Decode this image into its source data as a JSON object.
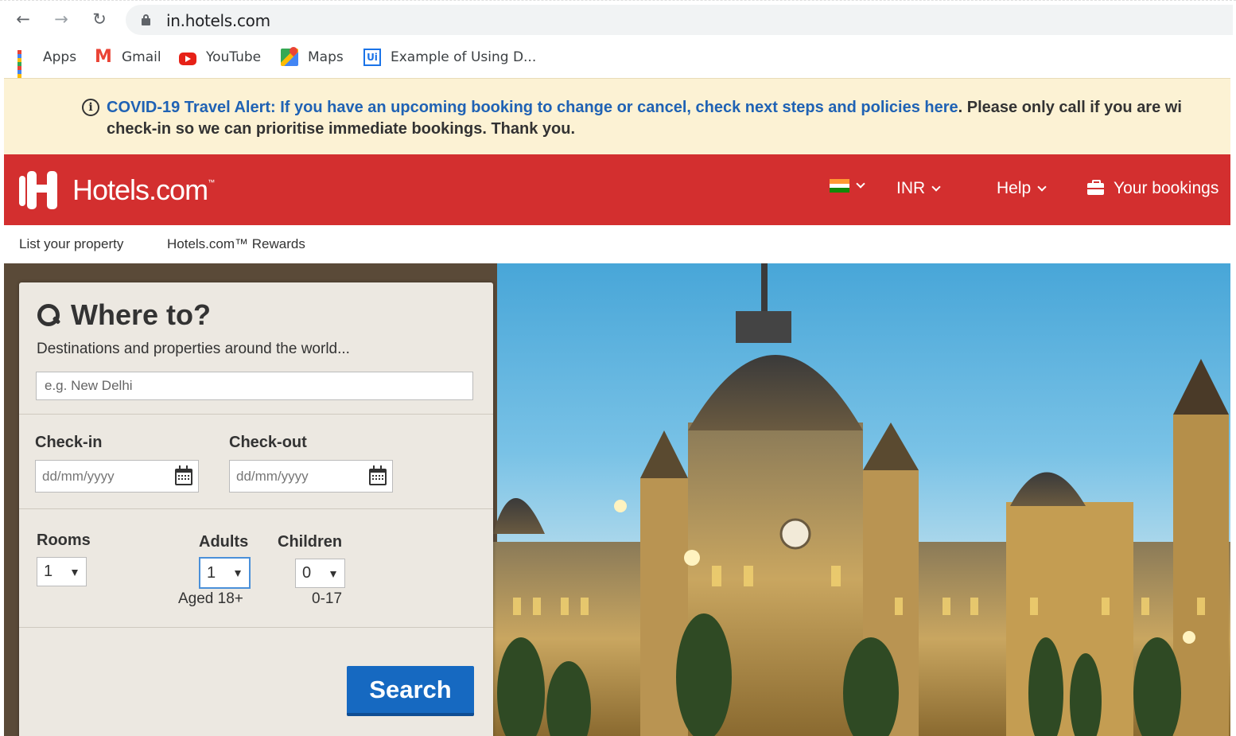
{
  "browser": {
    "url": "in.hotels.com",
    "bookmarks": [
      {
        "icon": "apps-icon",
        "label": "Apps"
      },
      {
        "icon": "gmail-icon",
        "label": "Gmail"
      },
      {
        "icon": "youtube-icon",
        "label": "YouTube"
      },
      {
        "icon": "maps-icon",
        "label": "Maps"
      },
      {
        "icon": "uipath-icon",
        "label": "Example of Using D..."
      }
    ]
  },
  "alert": {
    "icon": "info-icon",
    "link_text": "COVID-19 Travel Alert: If you have an upcoming booking to change or cancel, check next steps and policies here",
    "text_line1_rest": ". Please only call if you are wi",
    "text_line2": "check-in so we can prioritise immediate bookings. Thank you."
  },
  "header": {
    "brand": "Hotels.com",
    "trademark": "™",
    "currency": "INR",
    "help": "Help",
    "bookings": "Your bookings",
    "brand_color": "#d32f2f"
  },
  "subnav": {
    "list_property": "List your property",
    "rewards": "Hotels.com™ Rewards"
  },
  "search": {
    "title": "Where to?",
    "subtitle": "Destinations and properties around the world...",
    "destination_placeholder": "e.g. New Delhi",
    "checkin_label": "Check-in",
    "checkout_label": "Check-out",
    "date_placeholder": "dd/mm/yyyy",
    "rooms_label": "Rooms",
    "rooms_value": "1",
    "adults_label": "Adults",
    "adults_value": "1",
    "adults_hint": "Aged 18+",
    "children_label": "Children",
    "children_value": "0",
    "children_hint": "0-17",
    "button": "Search",
    "button_color": "#1669c1"
  }
}
